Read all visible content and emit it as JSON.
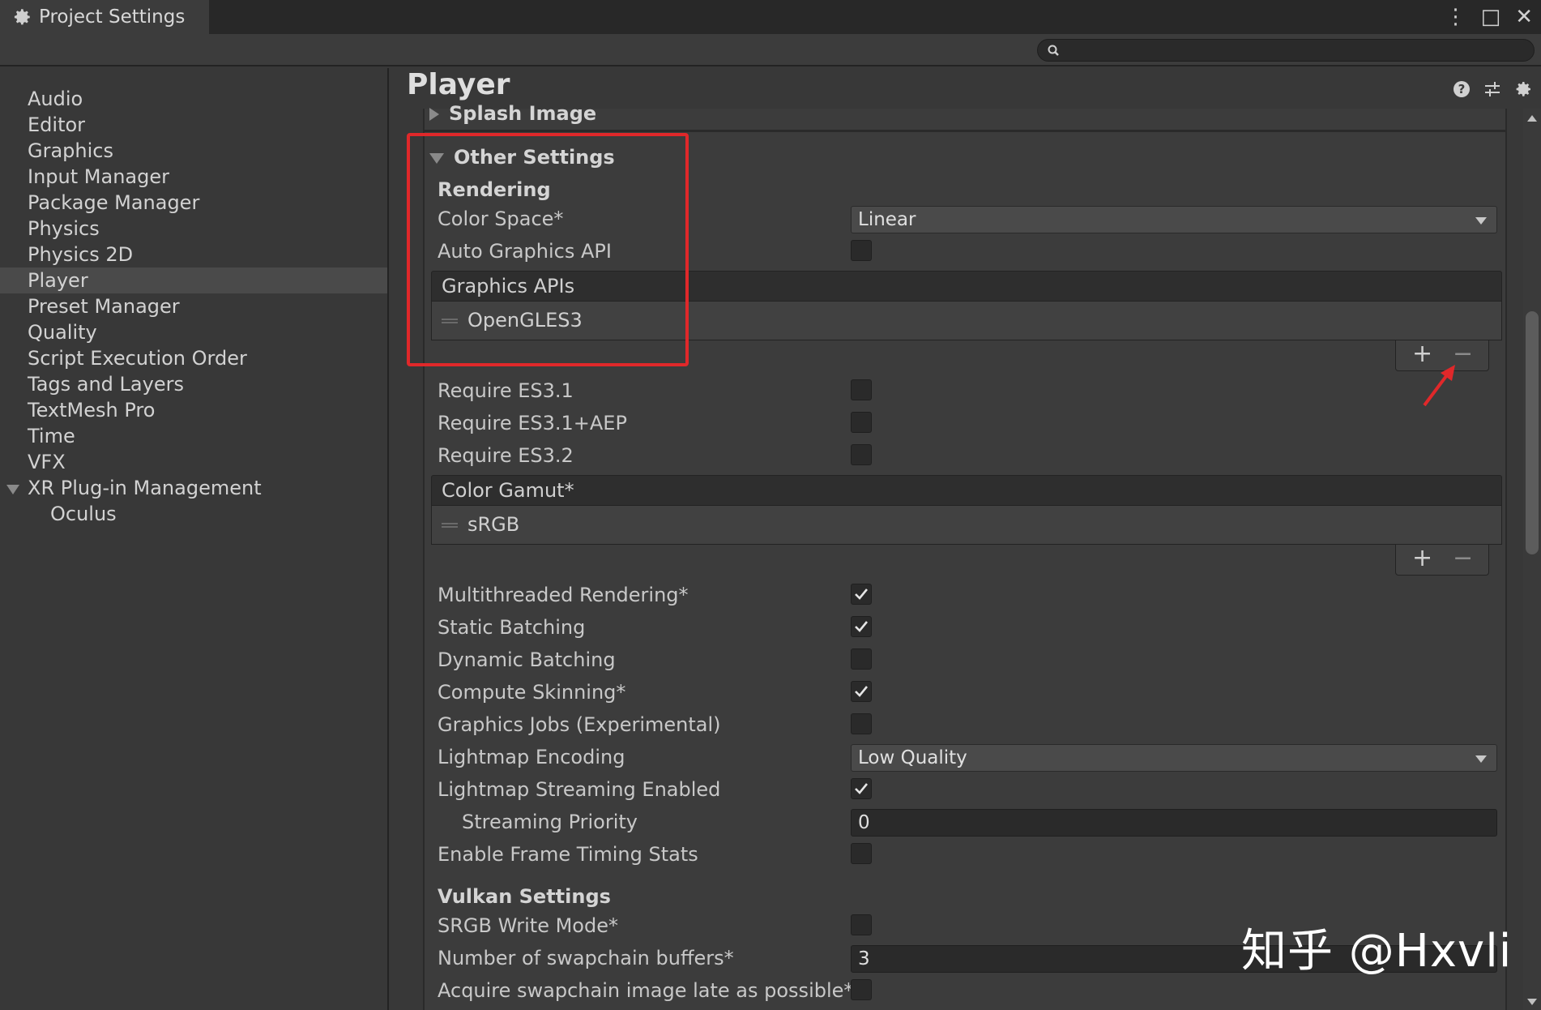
{
  "window": {
    "tab_title": "Project Settings",
    "controls": [
      "⋮",
      "□",
      "✕"
    ]
  },
  "sidebar": {
    "items": [
      {
        "label": "Audio"
      },
      {
        "label": "Editor"
      },
      {
        "label": "Graphics"
      },
      {
        "label": "Input Manager"
      },
      {
        "label": "Package Manager"
      },
      {
        "label": "Physics"
      },
      {
        "label": "Physics 2D"
      },
      {
        "label": "Player",
        "selected": true
      },
      {
        "label": "Preset Manager"
      },
      {
        "label": "Quality"
      },
      {
        "label": "Script Execution Order"
      },
      {
        "label": "Tags and Layers"
      },
      {
        "label": "TextMesh Pro"
      },
      {
        "label": "Time"
      },
      {
        "label": "VFX"
      },
      {
        "label": "XR Plug-in Management",
        "expanded": true
      },
      {
        "label": "Oculus",
        "child": true
      }
    ]
  },
  "main": {
    "title": "Player",
    "splash_section": "Splash Image",
    "other_section": "Other Settings",
    "rendering_header": "Rendering",
    "color_space": {
      "label": "Color Space*",
      "value": "Linear"
    },
    "auto_graphics_api": {
      "label": "Auto Graphics API",
      "checked": false
    },
    "graphics_apis": {
      "header": "Graphics APIs",
      "items": [
        "OpenGLES3"
      ]
    },
    "require_es31": {
      "label": "Require ES3.1",
      "checked": false
    },
    "require_es31aep": {
      "label": "Require ES3.1+AEP",
      "checked": false
    },
    "require_es32": {
      "label": "Require ES3.2",
      "checked": false
    },
    "color_gamut": {
      "header": "Color Gamut*",
      "items": [
        "sRGB"
      ]
    },
    "multithreaded": {
      "label": "Multithreaded Rendering*",
      "checked": true
    },
    "static_batching": {
      "label": "Static Batching",
      "checked": true
    },
    "dynamic_batching": {
      "label": "Dynamic Batching",
      "checked": false
    },
    "compute_skinning": {
      "label": "Compute Skinning*",
      "checked": true
    },
    "graphics_jobs": {
      "label": "Graphics Jobs (Experimental)",
      "checked": false
    },
    "lightmap_encoding": {
      "label": "Lightmap Encoding",
      "value": "Low Quality"
    },
    "lightmap_streaming": {
      "label": "Lightmap Streaming Enabled",
      "checked": true
    },
    "streaming_priority": {
      "label": "Streaming Priority",
      "value": "0"
    },
    "frame_timing": {
      "label": "Enable Frame Timing Stats",
      "checked": false
    },
    "vulkan_header": "Vulkan Settings",
    "srgb_write": {
      "label": "SRGB Write Mode*",
      "checked": false
    },
    "swapchain_buffers": {
      "label": "Number of swapchain buffers*",
      "value": "3"
    },
    "acquire_late": {
      "label": "Acquire swapchain image late as possible*",
      "checked": false
    },
    "list_plus": "+",
    "list_minus": "−"
  },
  "watermark": "知乎 @Hxvli",
  "colors": {
    "highlight": "#e0282a",
    "background": "#383838",
    "selected_row": "#4a4a4a"
  }
}
